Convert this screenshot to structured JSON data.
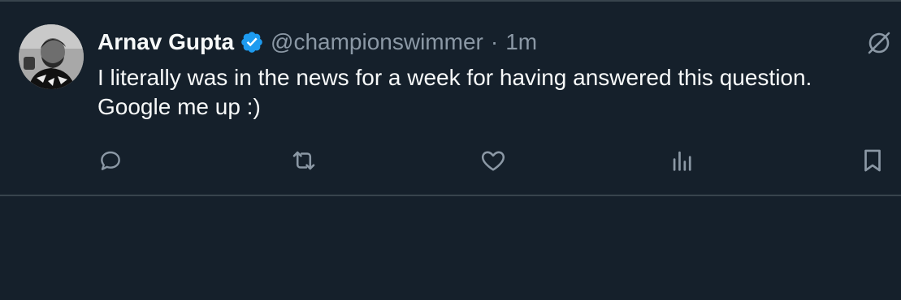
{
  "tweet": {
    "author_name": "Arnav Gupta",
    "handle": "@championswimmer",
    "separator": "·",
    "time": "1m",
    "text": "I literally was in the news for a week for having answered this question.\nGoogle me up :)"
  },
  "icons": {
    "verified": "verified-badge-icon",
    "more": "grok-icon",
    "reply": "reply-icon",
    "retweet": "retweet-icon",
    "like": "like-icon",
    "views": "views-icon",
    "bookmark": "bookmark-icon"
  },
  "colors": {
    "background": "#15202b",
    "primary_text": "#f7f9f9",
    "secondary_text": "#8b98a5",
    "verified": "#1d9bf0",
    "border": "#38444d"
  }
}
